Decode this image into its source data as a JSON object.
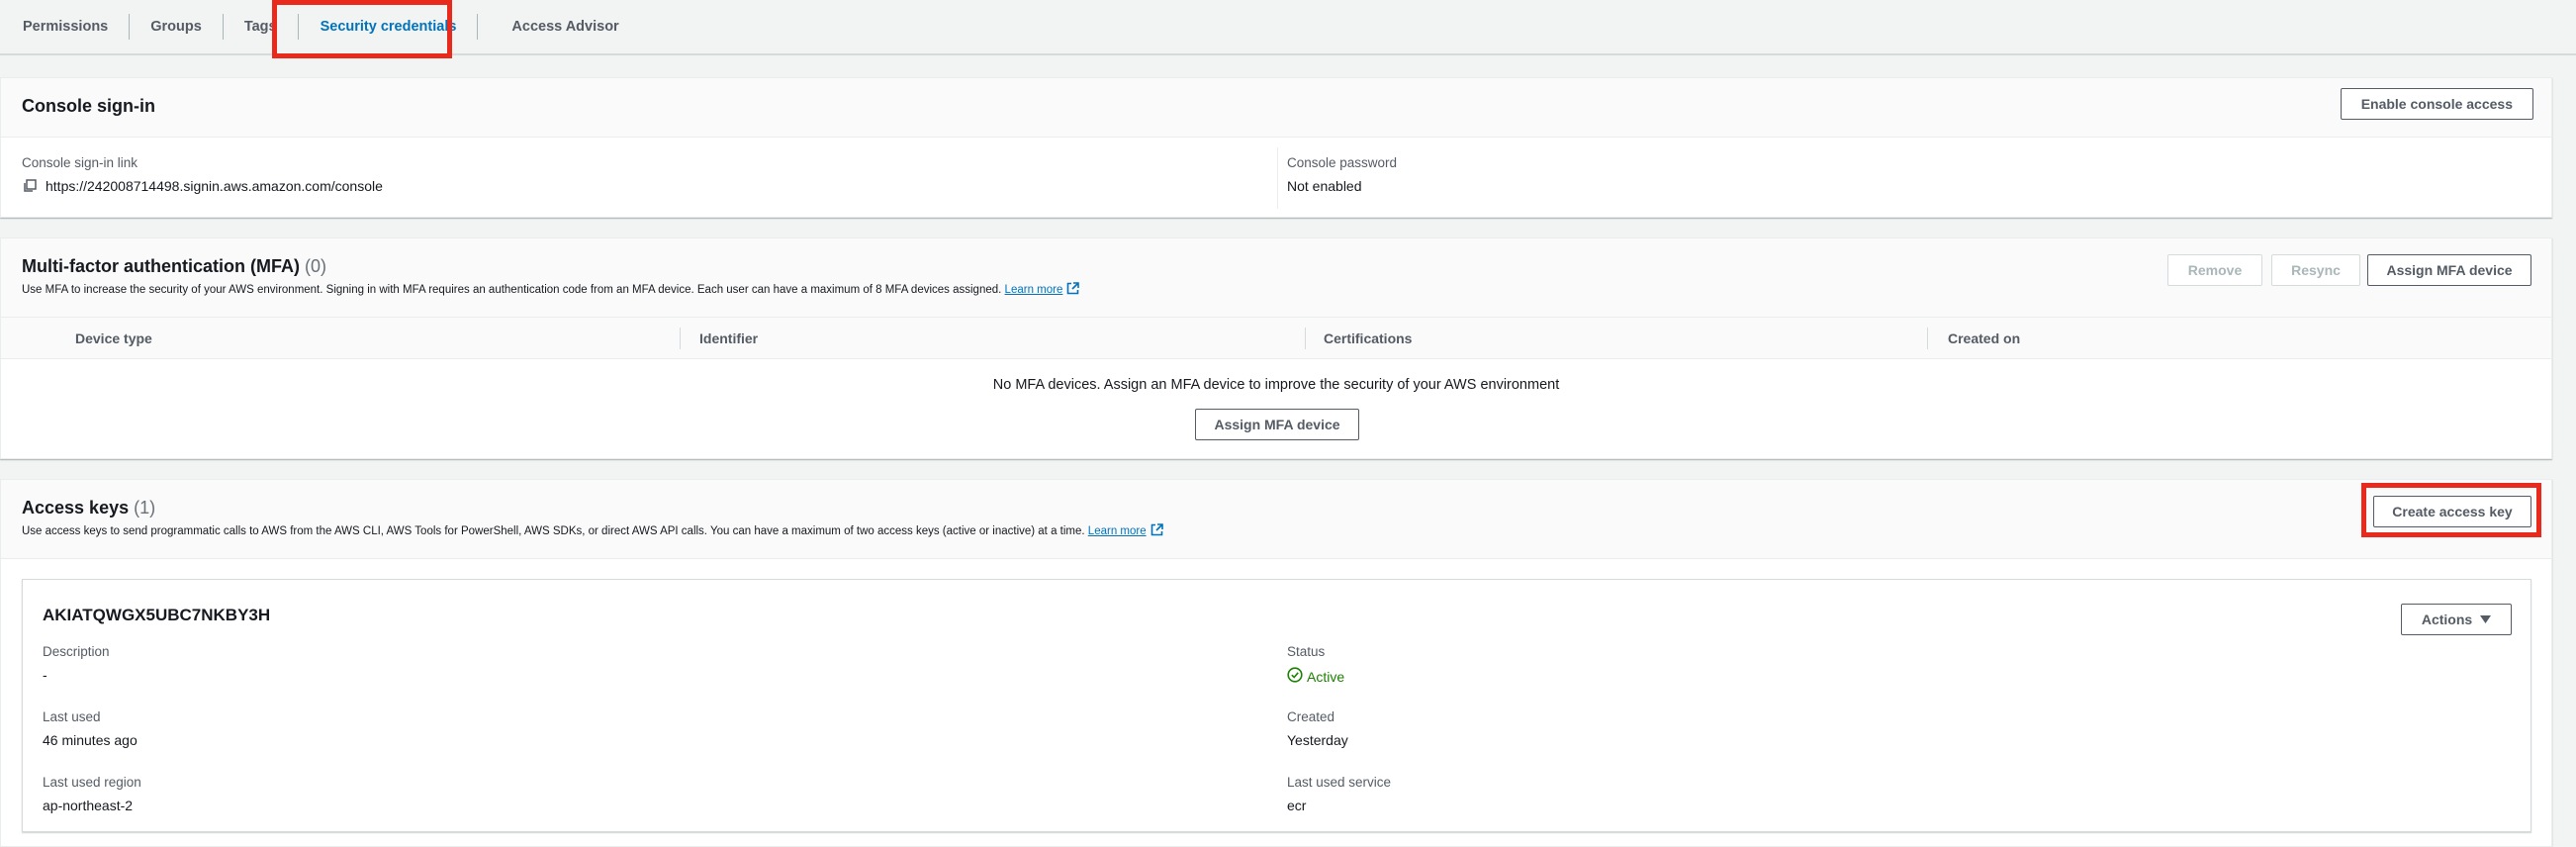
{
  "tabs": [
    {
      "label": "Permissions"
    },
    {
      "label": "Groups"
    },
    {
      "label": "Tags"
    },
    {
      "label": "Security credentials"
    },
    {
      "label": "Access Advisor"
    }
  ],
  "console_signin": {
    "title": "Console sign-in",
    "enable_button": "Enable console access",
    "link_label": "Console sign-in link",
    "link_value": "https://242008714498.signin.aws.amazon.com/console",
    "password_label": "Console password",
    "password_value": "Not enabled"
  },
  "mfa": {
    "title": "Multi-factor authentication (MFA)",
    "count": "(0)",
    "description": "Use MFA to increase the security of your AWS environment. Signing in with MFA requires an authentication code from an MFA device. Each user can have a maximum of 8 MFA devices assigned.",
    "learn_more": "Learn more",
    "remove_button": "Remove",
    "resync_button": "Resync",
    "assign_button": "Assign MFA device",
    "columns": [
      "Device type",
      "Identifier",
      "Certifications",
      "Created on"
    ],
    "empty_message": "No MFA devices. Assign an MFA device to improve the security of your AWS environment",
    "empty_assign_button": "Assign MFA device"
  },
  "access_keys": {
    "title": "Access keys",
    "count": "(1)",
    "description": "Use access keys to send programmatic calls to AWS from the AWS CLI, AWS Tools for PowerShell, AWS SDKs, or direct AWS API calls. You can have a maximum of two access keys (active or inactive) at a time.",
    "learn_more": "Learn more",
    "create_button": "Create access key",
    "key": {
      "id": "AKIATQWGX5UBC7NKBY3H",
      "actions_button": "Actions",
      "description_label": "Description",
      "description_value": "-",
      "status_label": "Status",
      "status_value": "Active",
      "last_used_label": "Last used",
      "last_used_value": "46 minutes ago",
      "created_label": "Created",
      "created_value": "Yesterday",
      "last_region_label": "Last used region",
      "last_region_value": "ap-northeast-2",
      "last_service_label": "Last used service",
      "last_service_value": "ecr"
    }
  },
  "colors": {
    "accent": "#0073bb",
    "highlight": "#e8291c",
    "status_active": "#1d8102"
  }
}
